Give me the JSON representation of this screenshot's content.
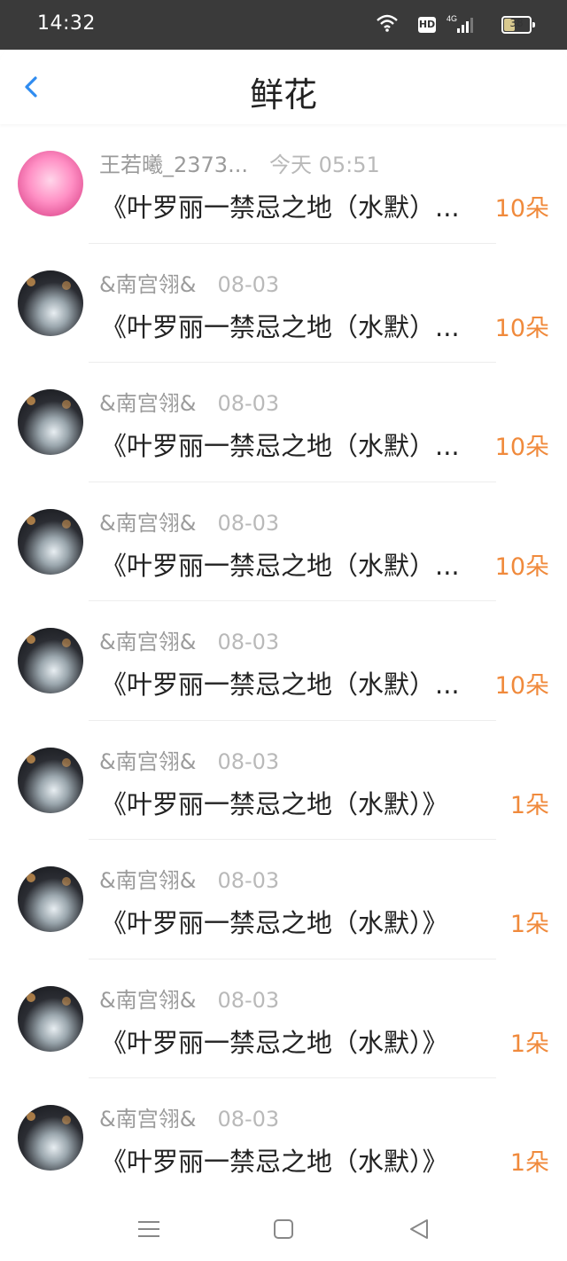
{
  "status_bar": {
    "time": "14:32",
    "network": "4G",
    "hd": "HD",
    "battery": "38"
  },
  "header": {
    "title": "鲜花"
  },
  "items": [
    {
      "user": "王若曦_2373...",
      "time": "今天 05:51",
      "text": "《叶罗丽一禁忌之地（水默）...",
      "amount": "10朵",
      "avatar": "pink-anime"
    },
    {
      "user": "&南宫翎&",
      "time": "08-03",
      "text": "《叶罗丽一禁忌之地（水默）...",
      "amount": "10朵",
      "avatar": "dark-portrait"
    },
    {
      "user": "&南宫翎&",
      "time": "08-03",
      "text": "《叶罗丽一禁忌之地（水默）...",
      "amount": "10朵",
      "avatar": "dark-portrait"
    },
    {
      "user": "&南宫翎&",
      "time": "08-03",
      "text": "《叶罗丽一禁忌之地（水默）...",
      "amount": "10朵",
      "avatar": "dark-portrait"
    },
    {
      "user": "&南宫翎&",
      "time": "08-03",
      "text": "《叶罗丽一禁忌之地（水默）...",
      "amount": "10朵",
      "avatar": "dark-portrait"
    },
    {
      "user": "&南宫翎&",
      "time": "08-03",
      "text": "《叶罗丽一禁忌之地（水默）》",
      "amount": "1朵",
      "avatar": "dark-portrait"
    },
    {
      "user": "&南宫翎&",
      "time": "08-03",
      "text": "《叶罗丽一禁忌之地（水默）》",
      "amount": "1朵",
      "avatar": "dark-portrait"
    },
    {
      "user": "&南宫翎&",
      "time": "08-03",
      "text": "《叶罗丽一禁忌之地（水默）》",
      "amount": "1朵",
      "avatar": "dark-portrait"
    },
    {
      "user": "&南宫翎&",
      "time": "08-03",
      "text": "《叶罗丽一禁忌之地（水默）》",
      "amount": "1朵",
      "avatar": "dark-portrait"
    }
  ],
  "nav_icons": {
    "menu": "menu-icon",
    "home": "home-icon",
    "back": "back-icon"
  },
  "colors": {
    "accent": "#2f8cf0",
    "amount": "#f08a3c",
    "meta": "#9b9b9b"
  }
}
